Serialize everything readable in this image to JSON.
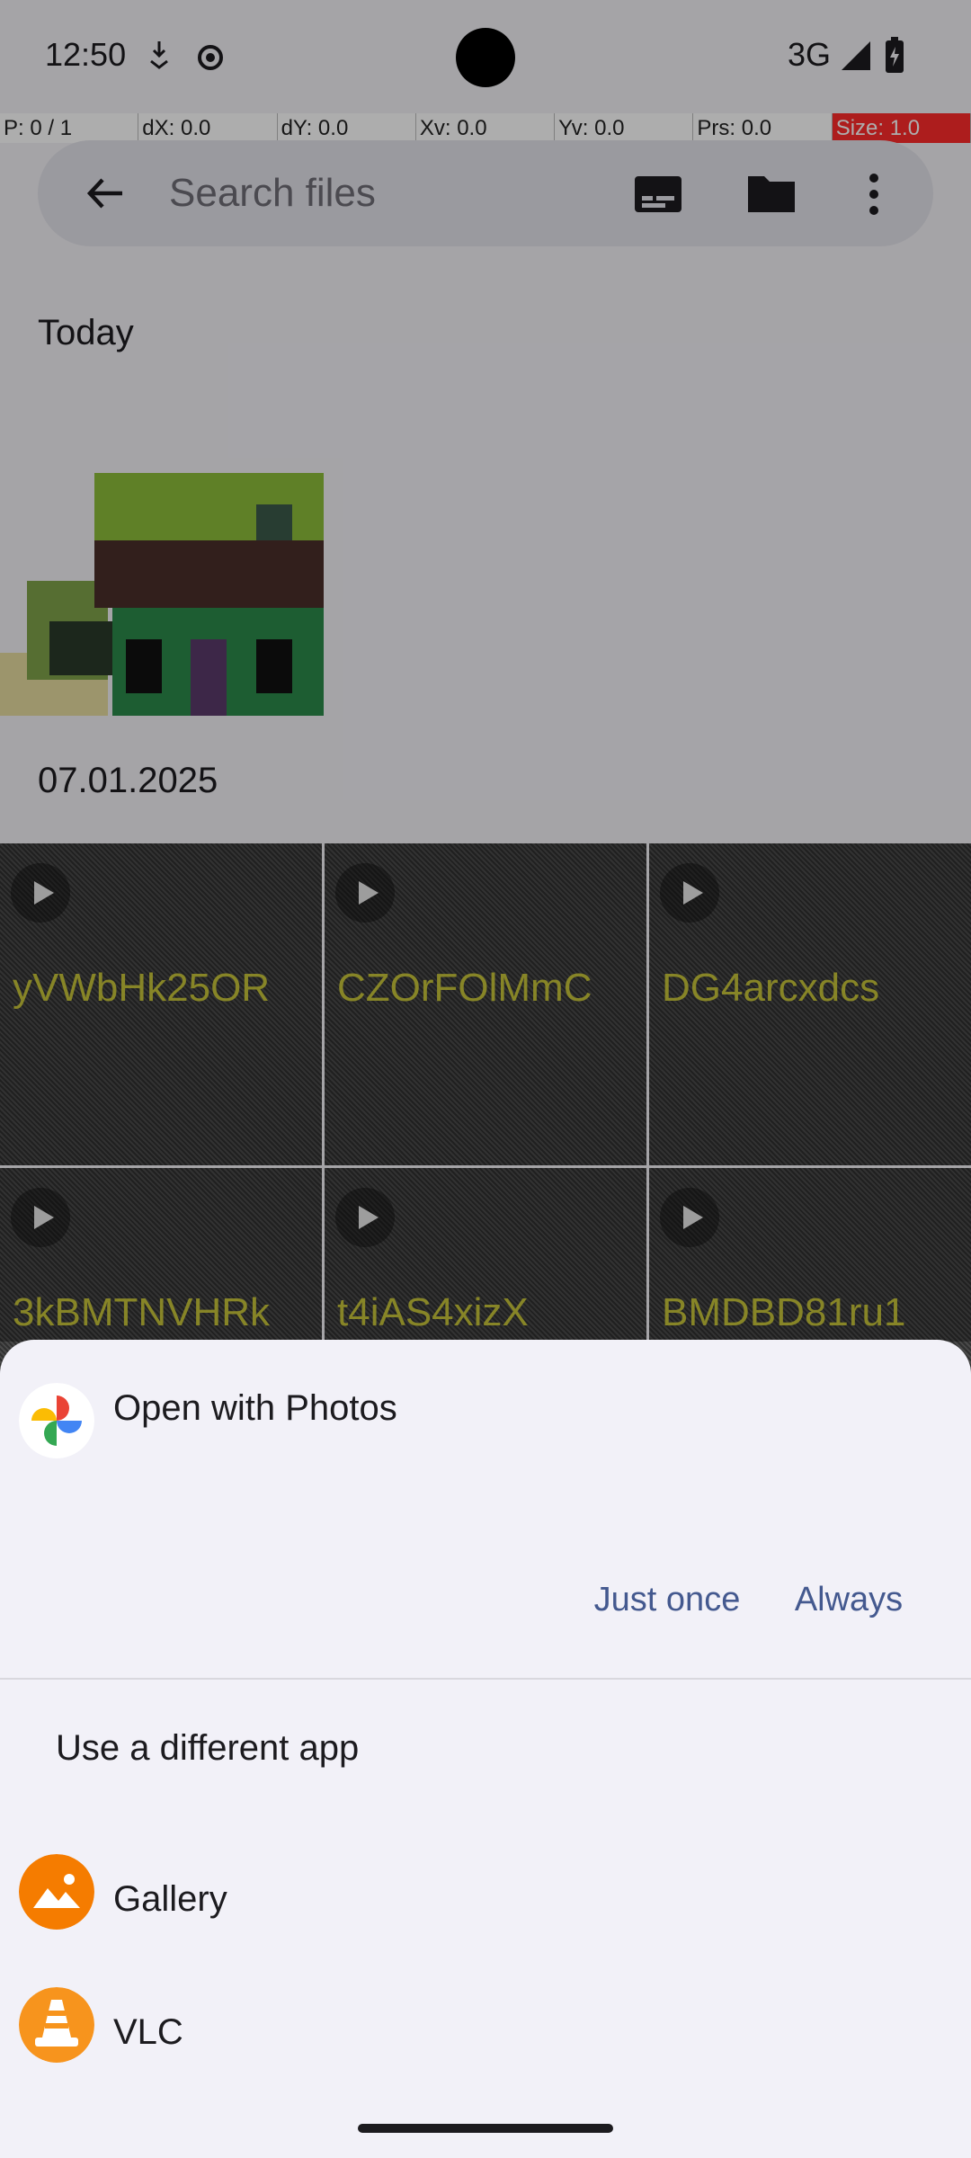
{
  "status": {
    "time": "12:50",
    "network": "3G"
  },
  "debug": [
    "P: 0 / 1",
    "dX: 0.0",
    "dY: 0.0",
    "Xv: 0.0",
    "Yv: 0.0",
    "Prs: 0.0",
    "Size: 1.0"
  ],
  "search": {
    "placeholder": "Search files"
  },
  "sections": {
    "today": "Today",
    "date": "07.01.2025"
  },
  "videos": [
    "yVWbHk25OR",
    "CZOrFOlMmC",
    "DG4arcxdcs",
    "3kBMTNVHRk",
    "t4iAS4xizX",
    "BMDBD81ru1"
  ],
  "sheet": {
    "open_with": "Open with Photos",
    "just_once": "Just once",
    "always": "Always",
    "use_different": "Use a different app",
    "apps": [
      "Gallery",
      "VLC"
    ]
  },
  "colors": {
    "accent": "#44598f",
    "sheet_bg": "#f2f1f8"
  }
}
